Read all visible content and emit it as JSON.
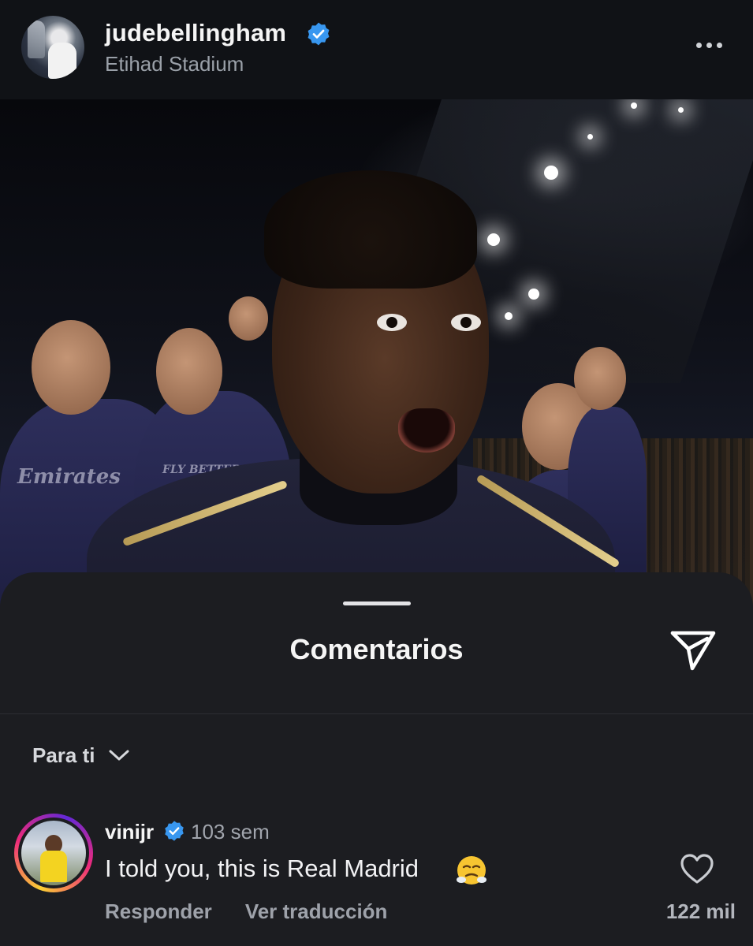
{
  "post": {
    "username": "judebellingham",
    "location": "Etihad Stadium",
    "image_alt": "",
    "shirt_sponsor": "Emirates",
    "shirt_slogan": "FLY BETTER"
  },
  "comments_sheet": {
    "title": "Comentarios",
    "filter_label": "Para ti",
    "comments": [
      {
        "username": "vinijr",
        "time": "103 sem",
        "text": "I told you, this is Real Madrid",
        "emoji": "😤",
        "reply_label": "Responder",
        "translate_label": "Ver traducción",
        "likes": "122 mil"
      }
    ]
  },
  "icons": {
    "verified": "verified-badge-icon",
    "more": "more-options-icon",
    "share": "paper-plane-icon",
    "chevron": "chevron-down-icon",
    "like": "heart-outline-icon"
  },
  "colors": {
    "background": "#101216",
    "sheet": "#1c1d21",
    "verified_blue": "#3897f0",
    "secondary_text": "#9aa0a8"
  }
}
